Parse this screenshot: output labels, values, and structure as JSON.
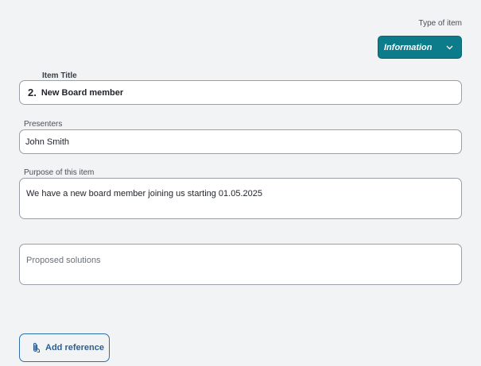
{
  "type_of_item": {
    "label": "Type of item",
    "selected": "Information"
  },
  "item_title": {
    "label": "Item Title",
    "number": "2.",
    "value": "New Board member"
  },
  "presenters": {
    "label": "Presenters",
    "value": "John Smith"
  },
  "purpose": {
    "label": "Purpose of this item",
    "value": "We have a new board member joining us starting 01.05.2025"
  },
  "proposed_solutions": {
    "placeholder": "Proposed solutions"
  },
  "add_reference": {
    "label": "Add reference",
    "icon": "paperclip-icon"
  },
  "colors": {
    "accent": "#0c7b8a",
    "link": "#2f6fa8",
    "background": "#f1f3f5"
  }
}
